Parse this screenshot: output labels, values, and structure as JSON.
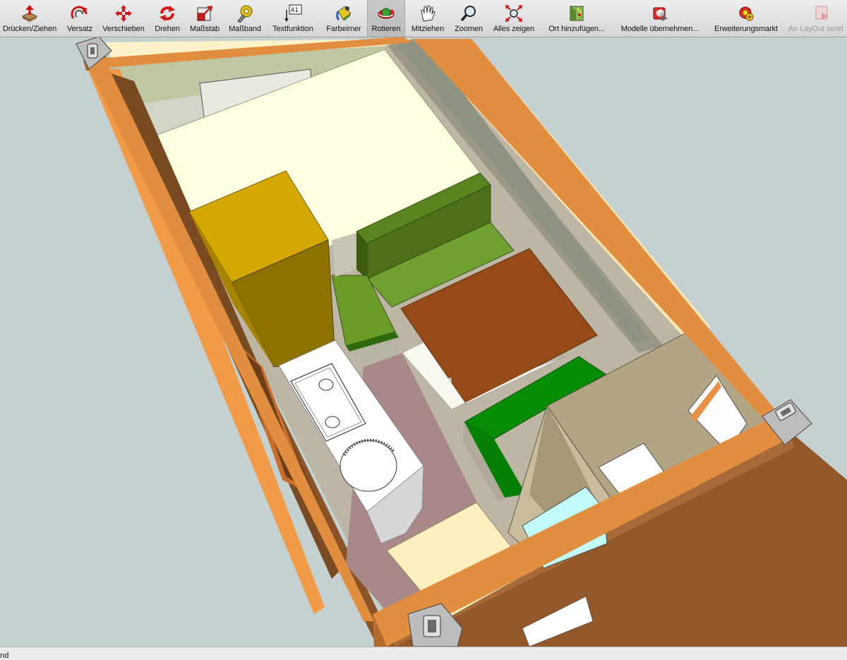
{
  "toolbar": {
    "tools": [
      {
        "id": "push-pull",
        "label": "Drücken/Ziehen",
        "icon": "push-pull-icon"
      },
      {
        "id": "offset",
        "label": "Versatz",
        "icon": "offset-icon"
      },
      {
        "id": "move",
        "label": "Verschieben",
        "icon": "move-icon"
      },
      {
        "id": "rotate",
        "label": "Drehen",
        "icon": "rotate-icon"
      },
      {
        "id": "scale",
        "label": "Maßstab",
        "icon": "scale-icon"
      },
      {
        "id": "tape-measure",
        "label": "Maßband",
        "icon": "tape-measure-icon"
      },
      {
        "id": "text",
        "label": "Textfunktion",
        "icon": "text-tool-icon"
      },
      {
        "id": "paint-bucket",
        "label": "Farbeimer",
        "icon": "paint-bucket-icon"
      },
      {
        "id": "orbit",
        "label": "Rotieren",
        "icon": "orbit-icon",
        "active": true
      },
      {
        "id": "pan",
        "label": "Mitziehen",
        "icon": "pan-hand-icon"
      },
      {
        "id": "zoom",
        "label": "Zoomen",
        "icon": "zoom-icon"
      },
      {
        "id": "zoom-extents",
        "label": "Alles zeigen",
        "icon": "zoom-extents-icon"
      },
      {
        "id": "add-location",
        "label": "Ort hinzufügen...",
        "icon": "add-location-icon"
      },
      {
        "id": "get-models",
        "label": "Modelle übernehmen...",
        "icon": "get-models-icon"
      },
      {
        "id": "extension-warehouse",
        "label": "Erweiterungsmarkt",
        "icon": "extension-warehouse-icon"
      },
      {
        "id": "send-to-layout",
        "label": "An LayOut send",
        "icon": "send-to-layout-icon",
        "disabled": true
      }
    ],
    "text_icon_glyph": "A1"
  },
  "status": {
    "text": "and"
  },
  "colors": {
    "background": "#c5d1d1",
    "wall_orange": "#e18e40",
    "wall_brown": "#7d4a22",
    "cabinet_yellow": "#d2a800",
    "seat_green": "#6e9a2c",
    "seat_green_bright": "#078c07",
    "table_brown": "#964a17",
    "floor_mauve": "#a88888",
    "bed_cream": "#fefee0",
    "water_cyan": "#c2fafa",
    "axis_green": "#1ab81a",
    "axis_blue": "#2a3adb"
  }
}
